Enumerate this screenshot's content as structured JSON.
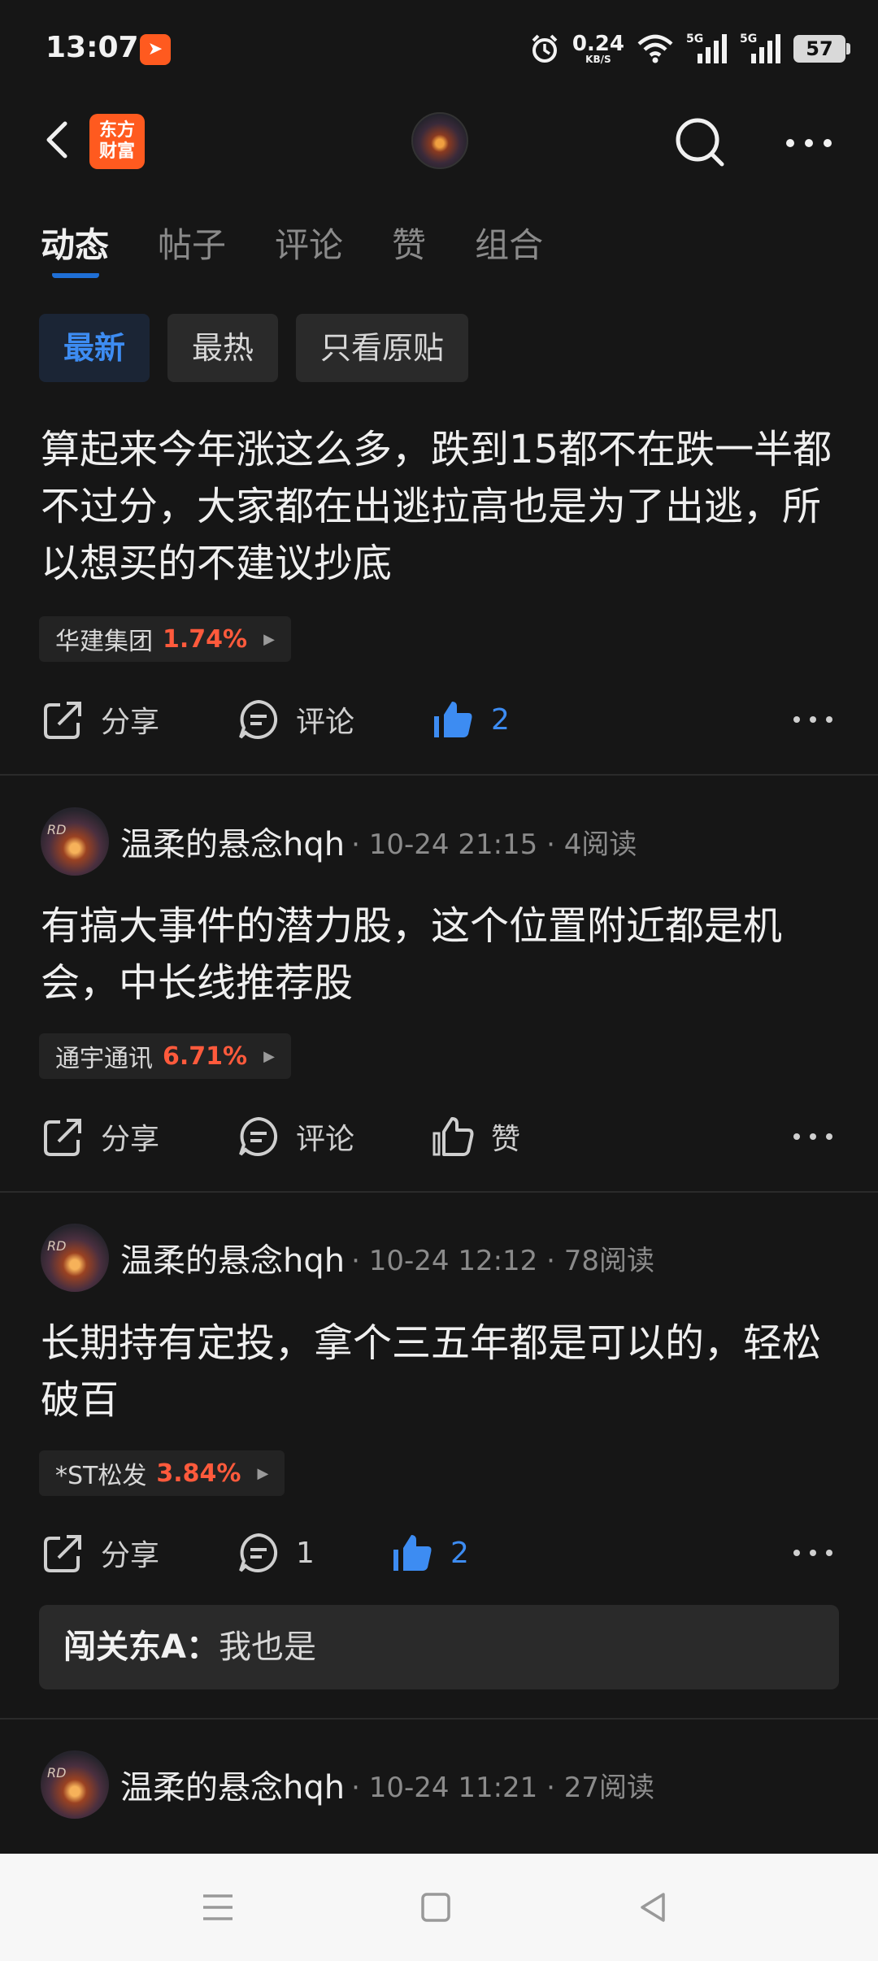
{
  "status_bar": {
    "time": "13:07",
    "speed_value": "0.24",
    "speed_unit": "KB/S",
    "sig1": "5G",
    "sig2": "5G",
    "battery": "57"
  },
  "header": {
    "logo_line1": "东方",
    "logo_line2": "财富"
  },
  "tabs": [
    {
      "label": "动态"
    },
    {
      "label": "帖子"
    },
    {
      "label": "评论"
    },
    {
      "label": "赞"
    },
    {
      "label": "组合"
    }
  ],
  "filters": [
    {
      "label": "最新"
    },
    {
      "label": "最热"
    },
    {
      "label": "只看原贴"
    }
  ],
  "posts": [
    {
      "content": "算起来今年涨这么多，跌到15都不在跌一半都不过分，大家都在出逃拉高也是为了出逃，所以想买的不建议抄底",
      "stock_name": "华建集团",
      "stock_pct": "1.74%",
      "share": "分享",
      "comment": "评论",
      "like": "2"
    },
    {
      "author": "温柔的悬念hqh",
      "meta": "· 10-24 21:15 · 4阅读",
      "content": "有搞大事件的潜力股，这个位置附近都是机会，中长线推荐股",
      "stock_name": "通宇通讯",
      "stock_pct": "6.71%",
      "share": "分享",
      "comment": "评论",
      "like": "赞"
    },
    {
      "author": "温柔的悬念hqh",
      "meta": "· 10-24 12:12 · 78阅读",
      "content": "长期持有定投，拿个三五年都是可以的，轻松破百",
      "stock_name": "*ST松发",
      "stock_pct": "3.84%",
      "share": "分享",
      "comment": "1",
      "like": "2",
      "reply_name": "闯关东A：",
      "reply_text": "我也是"
    },
    {
      "author": "温柔的悬念hqh",
      "meta": "· 10-24 11:21 · 27阅读"
    }
  ],
  "colors": {
    "accent": "#3d8cf2",
    "up": "#ff5a3c",
    "brand": "#ff5a1f"
  }
}
